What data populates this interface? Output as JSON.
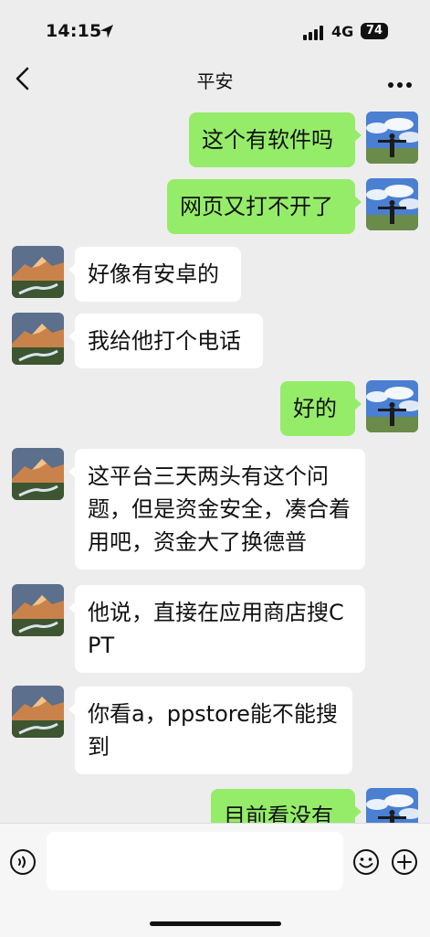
{
  "status_bar": {
    "time": "14:15",
    "network": "4G",
    "battery": "74",
    "icons": [
      "location-arrow-icon",
      "signal-icon"
    ]
  },
  "nav": {
    "title": "平安",
    "icons": [
      "back-chevron-icon",
      "more-dots-icon"
    ]
  },
  "messages": [
    {
      "side": "right",
      "text": "这个有软件吗",
      "avatar": "person-sky-photo"
    },
    {
      "side": "right",
      "text": "网页又打不开了",
      "avatar": "person-sky-photo"
    },
    {
      "side": "left",
      "text": "好像有安卓的",
      "avatar": "mountain-landscape-photo"
    },
    {
      "side": "left",
      "text": "我给他打个电话",
      "avatar": "mountain-landscape-photo"
    },
    {
      "side": "right",
      "text": "好的",
      "avatar": "person-sky-photo"
    },
    {
      "side": "left",
      "text": "这平台三天两头有这个问题，但是资金安全，凑合着用吧，资金大了换德普",
      "avatar": "mountain-landscape-photo"
    },
    {
      "side": "left",
      "text": "他说，直接在应用商店搜CPT",
      "avatar": "mountain-landscape-photo"
    },
    {
      "side": "left",
      "text": "你看a，ppstore能不能搜到",
      "avatar": "mountain-landscape-photo"
    },
    {
      "side": "right",
      "text": "目前看没有",
      "avatar": "person-sky-photo"
    }
  ],
  "input_bar": {
    "value": "",
    "icons": [
      "voice-icon",
      "emoji-icon",
      "plus-icon"
    ]
  },
  "colors": {
    "background": "#ededed",
    "sent_bubble": "#95ec69",
    "received_bubble": "#ffffff"
  }
}
